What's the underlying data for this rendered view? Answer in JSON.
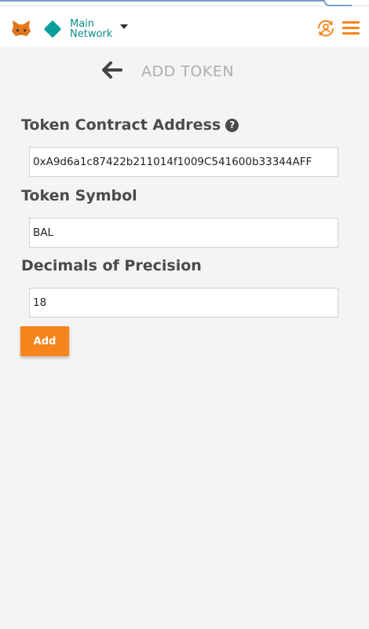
{
  "header": {
    "network_line1": "Main",
    "network_line2": "Network",
    "network_color": "#0a9f9a",
    "accent_color": "#f6851b",
    "icons": [
      "metamask-fox-icon",
      "network-diamond-icon",
      "chevron-down-icon",
      "account-switch-icon",
      "hamburger-menu-icon"
    ]
  },
  "page": {
    "title": "ADD TOKEN",
    "back_icon": "arrow-left-icon"
  },
  "form": {
    "contract_label": "Token Contract Address",
    "contract_help_glyph": "?",
    "contract_value": "0xA9d6a1c87422b211014f1009C541600b33344AFF",
    "symbol_label": "Token Symbol",
    "symbol_value": "BAL",
    "decimals_label": "Decimals of Precision",
    "decimals_value": "18",
    "add_label": "Add"
  }
}
